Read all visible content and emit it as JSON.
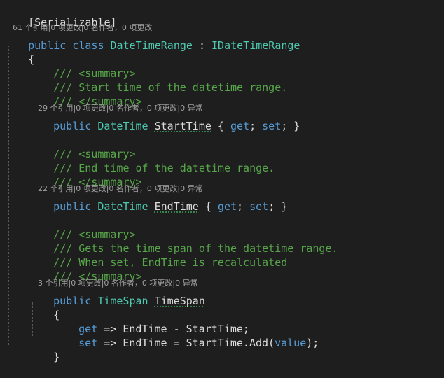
{
  "editor": {
    "attribute_line": "[Serializable]",
    "class_lens": "61 个引用|0 项更改|0 名作者，0 项更改",
    "class_decl": {
      "modifier": "public",
      "keyword": "class",
      "name": "DateTimeRange",
      "separator": " : ",
      "interface": "IDateTimeRange"
    },
    "open_brace": "{",
    "start_time": {
      "summary_open": "/// <summary>",
      "summary_text": "/// Start time of the datetime range.",
      "summary_close": "/// </summary>",
      "lens": "29 个引用|0 项更改|0 名作者，0 项更改|0 异常",
      "modifier": "public",
      "type": "DateTime",
      "name": "StartTime",
      "brace_open": " { ",
      "get": "get",
      "semi1": "; ",
      "set": "set",
      "tail": "; }"
    },
    "end_time": {
      "summary_open": "/// <summary>",
      "summary_text": "/// End time of the datetime range.",
      "summary_close": "/// </summary>",
      "lens": "22 个引用|0 项更改|0 名作者，0 项更改|0 异常",
      "modifier": "public",
      "type": "DateTime",
      "name": "EndTime",
      "brace_open": " { ",
      "get": "get",
      "semi1": "; ",
      "set": "set",
      "tail": "; }"
    },
    "time_span": {
      "summary_open": "/// <summary>",
      "summary_text1": "/// Gets the time span of the datetime range.",
      "summary_text2": "/// When set, EndTime is recalculated",
      "summary_close": "/// </summary>",
      "lens": "3 个引用|0 项更改|0 名作者，0 项更改|0 异常",
      "modifier": "public",
      "type": "TimeSpan",
      "name": "TimeSpan",
      "brace_open": "{",
      "getter_kw": "get",
      "getter_body": " => EndTime - StartTime;",
      "setter_kw": "set",
      "setter_body_a": " => EndTime = StartTime.Add(",
      "setter_value": "value",
      "setter_body_b": ");",
      "brace_close": "}"
    }
  },
  "colors": {
    "background": "#1e1e1e",
    "keyword": "#569cd6",
    "type": "#4ec9b0",
    "comment": "#57a64a",
    "text": "#dcdcdc",
    "lens": "#a0a0a0"
  }
}
